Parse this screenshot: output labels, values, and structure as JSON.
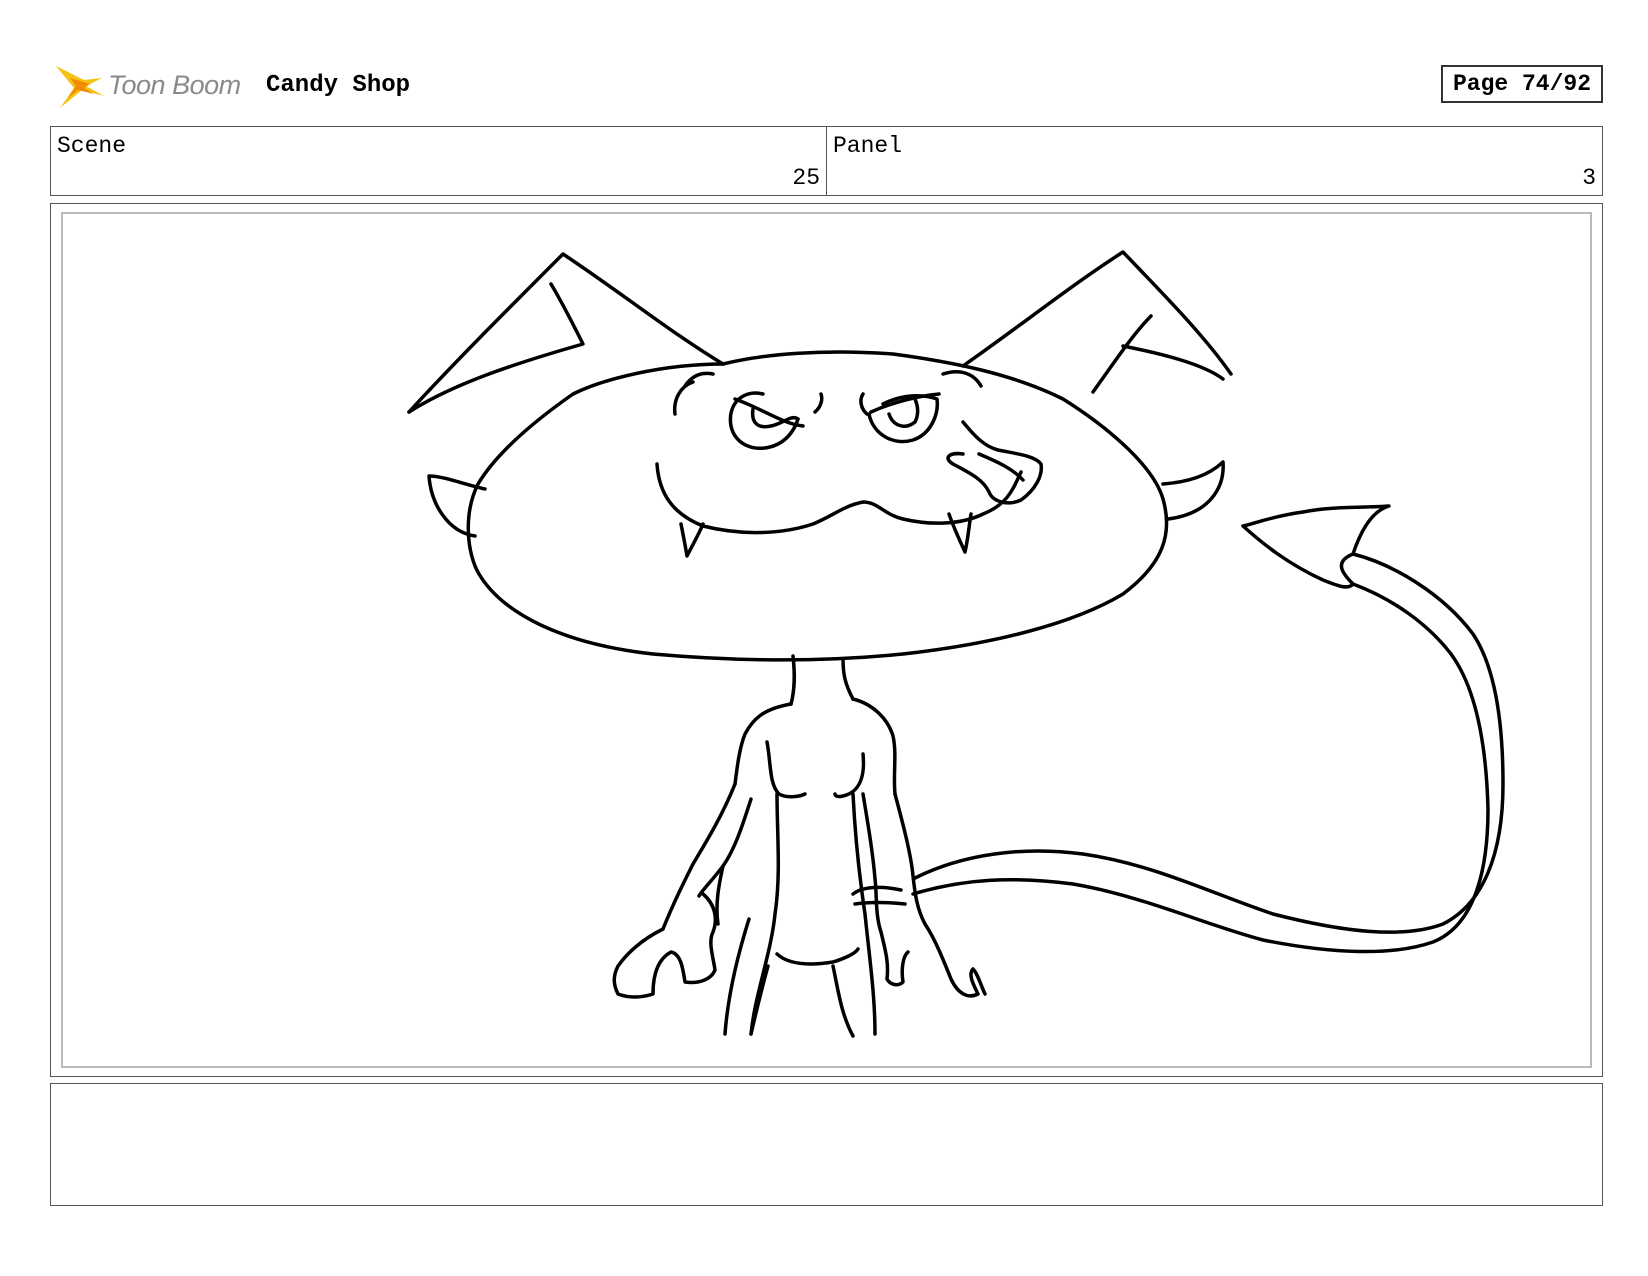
{
  "header": {
    "logo_text": "Toon Boom",
    "project_title": "Candy Shop",
    "page_number": "Page 74/92"
  },
  "scene": {
    "label": "Scene",
    "value": "25"
  },
  "panel": {
    "label": "Panel",
    "value": "3"
  },
  "notes": {
    "text": ""
  },
  "colors": {
    "logo_flame": "#f5c211",
    "logo_text": "#8a8a8a",
    "ink": "#000000",
    "frame_border": "#555555",
    "inner_frame_border": "#bbbbbb"
  },
  "drawing": {
    "subject": "devil-creature-sketch"
  }
}
